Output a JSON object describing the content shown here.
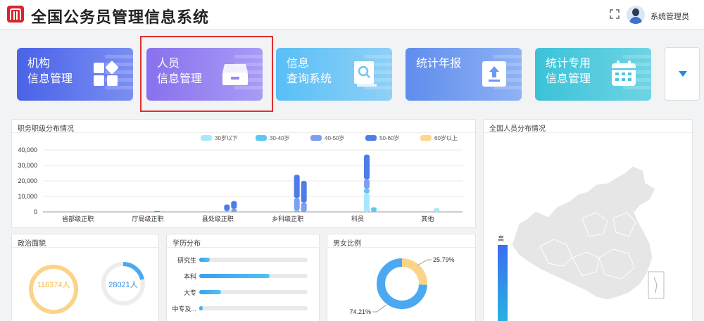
{
  "app": {
    "title": "全国公务员管理信息系统",
    "user": "系统管理员"
  },
  "modules": [
    {
      "label": "机构\n信息管理",
      "icon": "grid-icon"
    },
    {
      "label": "人员\n信息管理",
      "icon": "drawer-icon"
    },
    {
      "label": "信息\n查询系统",
      "icon": "search-book-icon"
    },
    {
      "label": "统计年报",
      "icon": "upload-icon"
    },
    {
      "label": "统计专用\n信息管理",
      "icon": "calendar-icon"
    }
  ],
  "rank_panel": {
    "title": "职务职级分布情况"
  },
  "map_panel": {
    "title": "全国人员分布情况",
    "legend_high": "高"
  },
  "politic_panel": {
    "title": "政治面貌",
    "value1": "116374人",
    "value2": "28021人"
  },
  "edu_panel": {
    "title": "学历分布",
    "rows": [
      {
        "label": "研究生",
        "fraction": 0.1
      },
      {
        "label": "本科",
        "fraction": 0.65
      },
      {
        "label": "大专",
        "fraction": 0.2
      },
      {
        "label": "中专及...",
        "fraction": 0.03
      }
    ]
  },
  "gender_panel": {
    "title": "男女比例",
    "pct1": "25.79%",
    "pct2": "74.21%",
    "share1": 25.79,
    "share2": 74.21
  },
  "colors": {
    "series": [
      "#a8e8fb",
      "#5cc8f4",
      "#7c9ff2",
      "#4f7de8",
      "#fdd68f"
    ],
    "gender": [
      "#fbd48a",
      "#4aa9f0"
    ]
  },
  "chart_data": {
    "type": "bar",
    "categories": [
      "省部级正职",
      "厅局级正职",
      "县处级正职",
      "乡科级正职",
      "科员",
      "其他"
    ],
    "ylim": [
      0,
      40000
    ],
    "yticks": [
      "40,000",
      "30,000",
      "20,000",
      "10,000",
      "0"
    ],
    "legend": "top-right",
    "series": [
      {
        "name": "30岁以下",
        "values": [
          [
            0,
            0
          ],
          [
            0,
            0
          ],
          [
            0,
            0
          ],
          [
            0,
            0
          ],
          [
            12000,
            0
          ],
          [
            2500,
            500
          ]
        ]
      },
      {
        "name": "30-40岁",
        "values": [
          [
            0,
            0
          ],
          [
            200,
            0
          ],
          [
            300,
            0
          ],
          [
            1000,
            0
          ],
          [
            3000,
            3000
          ],
          [
            0,
            0
          ]
        ]
      },
      {
        "name": "40-50岁",
        "values": [
          [
            0,
            0
          ],
          [
            200,
            0
          ],
          [
            500,
            2000
          ],
          [
            8000,
            6000
          ],
          [
            6000,
            0
          ],
          [
            0,
            0
          ]
        ]
      },
      {
        "name": "50-60岁",
        "values": [
          [
            0,
            0
          ],
          [
            100,
            0
          ],
          [
            4000,
            5000
          ],
          [
            15000,
            14000
          ],
          [
            16000,
            0
          ],
          [
            0,
            0
          ]
        ]
      },
      {
        "name": "60岁以上",
        "values": [
          [
            0,
            0
          ],
          [
            0,
            0
          ],
          [
            0,
            0
          ],
          [
            0,
            0
          ],
          [
            0,
            0
          ],
          [
            0,
            0
          ]
        ]
      }
    ]
  }
}
